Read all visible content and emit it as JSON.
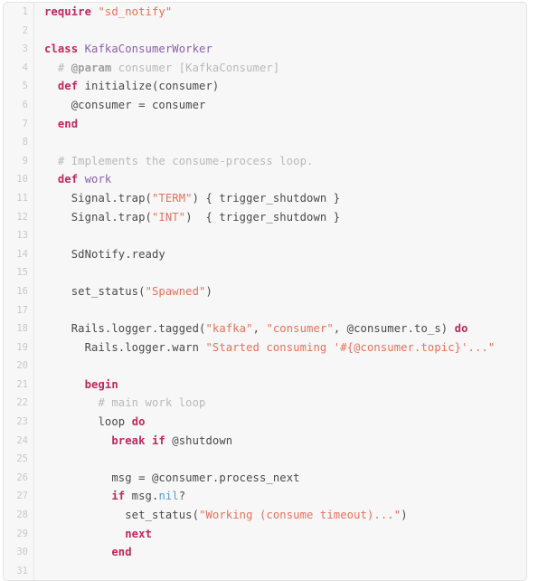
{
  "editor": {
    "language": "ruby",
    "colors": {
      "background": "#f7f7f7",
      "border": "#e4e4e4",
      "gutter_text": "#c8c8c8",
      "plain": "#4a4a4a",
      "keyword": "#c0275d",
      "class_name": "#8a5fae",
      "string": "#e8705a",
      "comment": "#b9b9b9",
      "constant": "#5b9bd5"
    },
    "first_line_number": 1,
    "last_line_number": 31,
    "line_numbers": [
      "1",
      "2",
      "3",
      "4",
      "5",
      "6",
      "7",
      "8",
      "9",
      "10",
      "11",
      "12",
      "13",
      "14",
      "15",
      "16",
      "17",
      "18",
      "19",
      "20",
      "21",
      "22",
      "23",
      "24",
      "25",
      "26",
      "27",
      "28",
      "29",
      "30",
      "31"
    ],
    "lines": [
      {
        "n": "1",
        "text": "require \"sd_notify\""
      },
      {
        "n": "2",
        "text": ""
      },
      {
        "n": "3",
        "text": "class KafkaConsumerWorker"
      },
      {
        "n": "4",
        "text": "  # @param consumer [KafkaConsumer]"
      },
      {
        "n": "5",
        "text": "  def initialize(consumer)"
      },
      {
        "n": "6",
        "text": "    @consumer = consumer"
      },
      {
        "n": "7",
        "text": "  end"
      },
      {
        "n": "8",
        "text": ""
      },
      {
        "n": "9",
        "text": "  # Implements the consume-process loop."
      },
      {
        "n": "10",
        "text": "  def work"
      },
      {
        "n": "11",
        "text": "    Signal.trap(\"TERM\") { trigger_shutdown }"
      },
      {
        "n": "12",
        "text": "    Signal.trap(\"INT\")  { trigger_shutdown }"
      },
      {
        "n": "13",
        "text": ""
      },
      {
        "n": "14",
        "text": "    SdNotify.ready"
      },
      {
        "n": "15",
        "text": ""
      },
      {
        "n": "16",
        "text": "    set_status(\"Spawned\")"
      },
      {
        "n": "17",
        "text": ""
      },
      {
        "n": "18",
        "text": "    Rails.logger.tagged(\"kafka\", \"consumer\", @consumer.to_s) do"
      },
      {
        "n": "19",
        "text": "      Rails.logger.warn \"Started consuming '#{@consumer.topic}'...\""
      },
      {
        "n": "20",
        "text": ""
      },
      {
        "n": "21",
        "text": "      begin"
      },
      {
        "n": "22",
        "text": "        # main work loop"
      },
      {
        "n": "23",
        "text": "        loop do"
      },
      {
        "n": "24",
        "text": "          break if @shutdown"
      },
      {
        "n": "25",
        "text": ""
      },
      {
        "n": "26",
        "text": "          msg = @consumer.process_next"
      },
      {
        "n": "27",
        "text": "          if msg.nil?"
      },
      {
        "n": "28",
        "text": "            set_status(\"Working (consume timeout)...\")"
      },
      {
        "n": "29",
        "text": "            next"
      },
      {
        "n": "30",
        "text": "          end"
      },
      {
        "n": "31",
        "text": ""
      }
    ]
  }
}
